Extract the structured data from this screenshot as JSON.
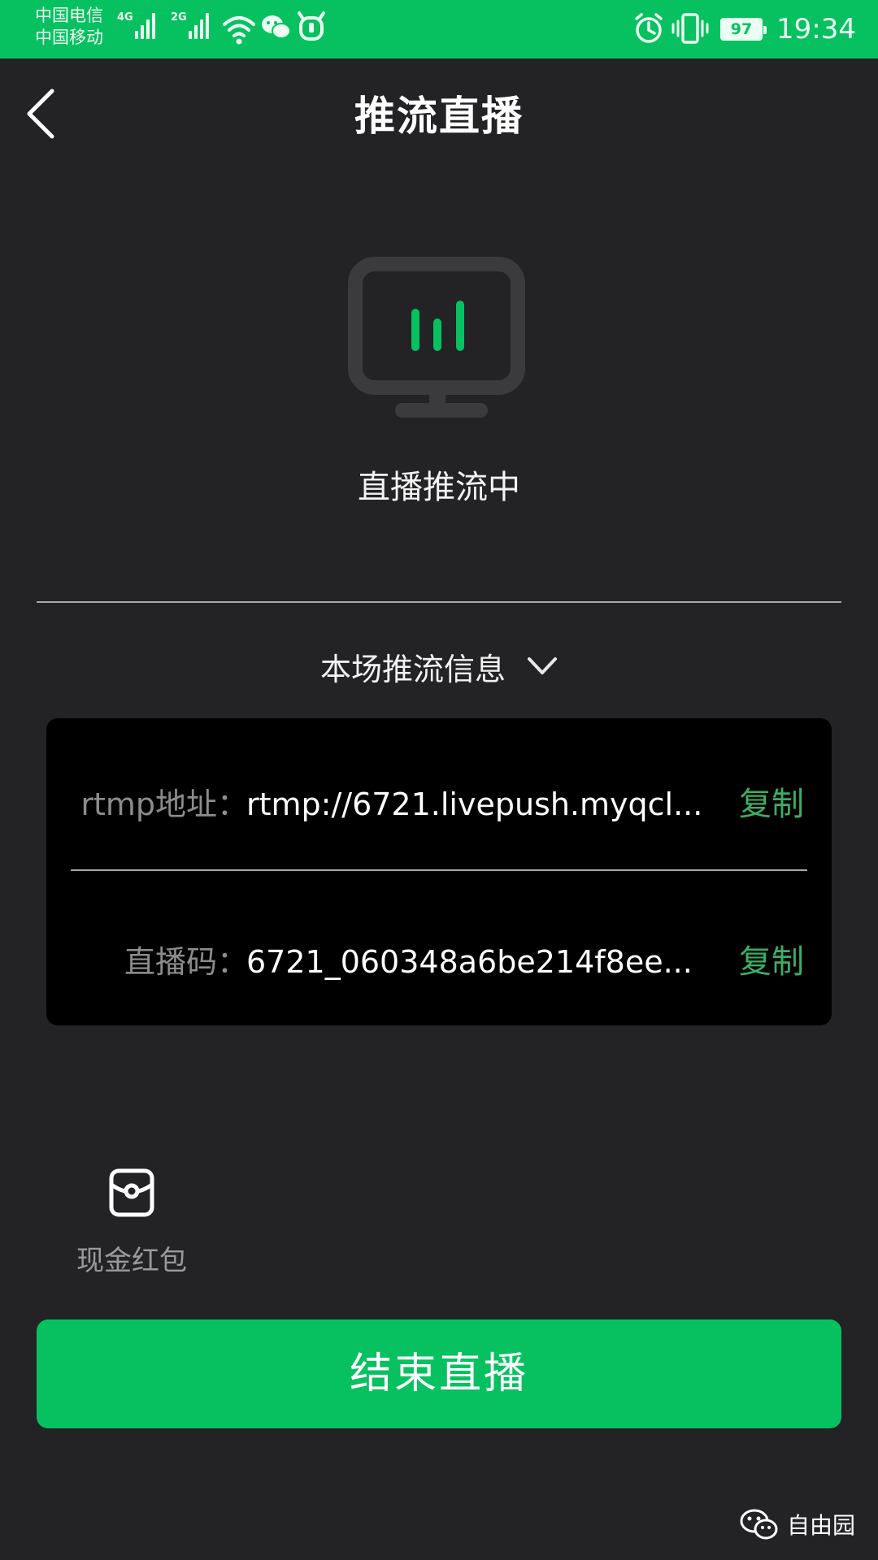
{
  "status_bar": {
    "carrier_1": "中国电信",
    "carrier_2": "中国移动",
    "sim1_network": "4G",
    "sim2_network": "2G",
    "battery_level": "97",
    "time": "19:34"
  },
  "nav": {
    "title": "推流直播"
  },
  "stream": {
    "status_text": "直播推流中"
  },
  "info_section": {
    "toggle_label": "本场推流信息"
  },
  "info_rows": [
    {
      "label": "rtmp地址：",
      "value": "rtmp://6721.livepush.myqcl...",
      "action": "复制"
    },
    {
      "label": "直播码：",
      "value": "6721_060348a6be214f8ee...",
      "action": "复制"
    }
  ],
  "tools": {
    "red_packet_label": "现金红包"
  },
  "end_button": {
    "label": "结束直播"
  },
  "watermark": {
    "text": "自由园"
  },
  "colors": {
    "accent": "#07c160",
    "background": "#232225",
    "card": "#000000",
    "copy": "#3ead63"
  },
  "icons": [
    "back-icon",
    "monitor-live-icon",
    "chevron-down-icon",
    "red-packet-icon",
    "wechat-icon"
  ]
}
